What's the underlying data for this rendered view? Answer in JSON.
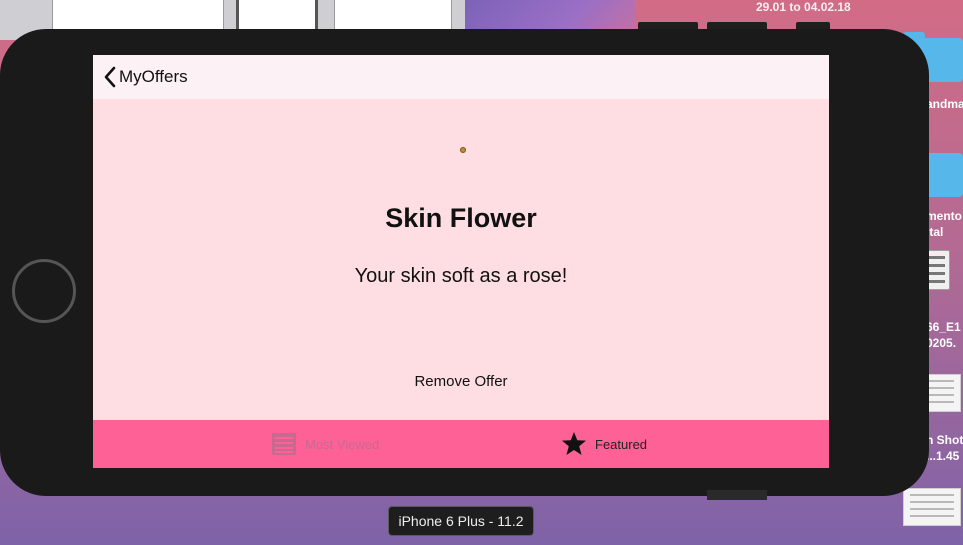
{
  "desktop": {
    "date_range": "29.01 to 04.02.18",
    "icons": [
      {
        "label": "andma",
        "kind": "folder"
      },
      {
        "label_line1": "mento I",
        "label_line2": "ital",
        "kind": "folder"
      },
      {
        "label_line1": "66_E1",
        "label_line2": "0205.",
        "kind": "spreadsheet"
      },
      {
        "label_line1": "n Shot",
        "label_line2": "...1.45",
        "kind": "screenshot"
      },
      {
        "kind": "document"
      }
    ]
  },
  "simulator": {
    "device_label": "iPhone 6 Plus - 11.2"
  },
  "app": {
    "nav": {
      "back_label": "MyOffers",
      "back_icon": "chevron-left-icon"
    },
    "offer": {
      "title": "Skin Flower",
      "description": "Your skin soft as a rose!",
      "remove_label": "Remove Offer"
    },
    "tab_bar": {
      "background": "#fd6196",
      "tabs": [
        {
          "label": "Most Viewed",
          "icon": "list-icon",
          "selected": false
        },
        {
          "label": "Featured",
          "icon": "star-icon",
          "selected": true
        }
      ]
    },
    "colors": {
      "screen_background": "#ffdee3",
      "nav_background": "#fcf1f4"
    }
  }
}
